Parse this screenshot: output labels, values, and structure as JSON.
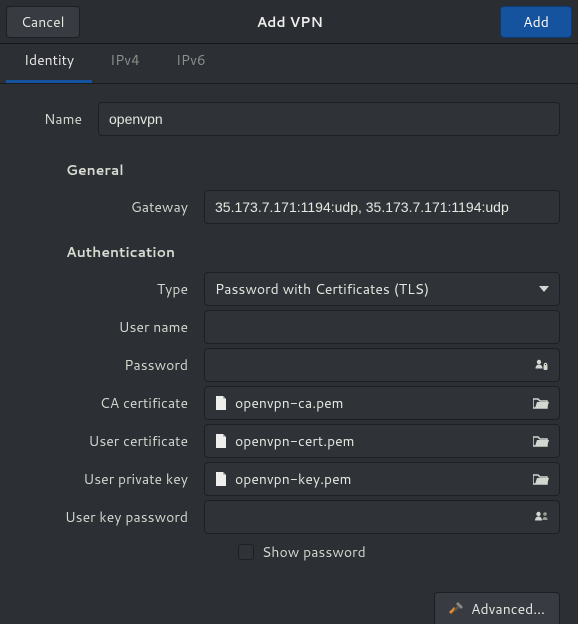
{
  "titlebar": {
    "cancel": "Cancel",
    "title": "Add VPN",
    "add": "Add"
  },
  "tabs": {
    "identity": "Identity",
    "ipv4": "IPv4",
    "ipv6": "IPv6"
  },
  "fields": {
    "name_label": "Name",
    "name_value": "openvpn"
  },
  "sections": {
    "general": "General",
    "authentication": "Authentication"
  },
  "general": {
    "gateway_label": "Gateway",
    "gateway_value": "35.173.7.171:1194:udp, 35.173.7.171:1194:udp"
  },
  "auth": {
    "type_label": "Type",
    "type_value": "Password with Certificates (TLS)",
    "username_label": "User name",
    "username_value": "",
    "password_label": "Password",
    "password_value": "",
    "ca_label": "CA certificate",
    "ca_file": "openvpn-ca.pem",
    "usercert_label": "User certificate",
    "usercert_file": "openvpn-cert.pem",
    "privkey_label": "User private key",
    "privkey_file": "openvpn-key.pem",
    "keypass_label": "User key password",
    "keypass_value": "",
    "show_password": "Show password"
  },
  "buttons": {
    "advanced": "Advanced…"
  },
  "colors": {
    "accent": "#15539e",
    "bg": "#2c2f33",
    "input_bg": "#2f3338",
    "btn_bg": "#383c42",
    "border": "#1d1f22"
  }
}
